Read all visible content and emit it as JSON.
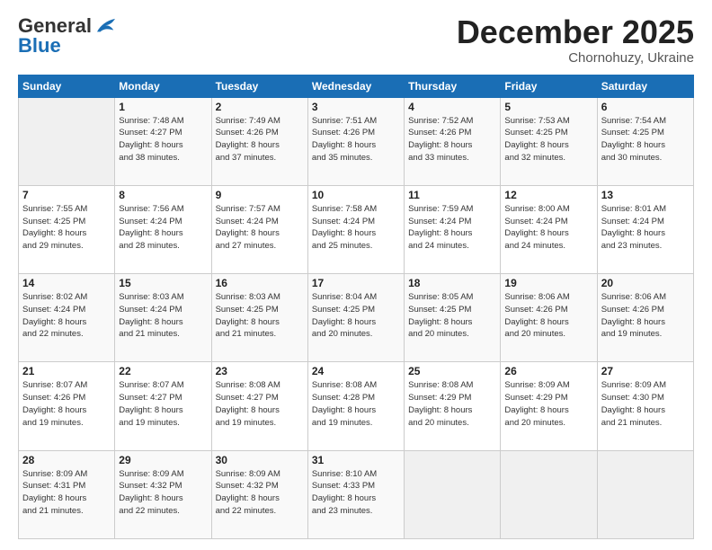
{
  "header": {
    "logo_general": "General",
    "logo_blue": "Blue",
    "month_title": "December 2025",
    "location": "Chornohuzy, Ukraine"
  },
  "weekdays": [
    "Sunday",
    "Monday",
    "Tuesday",
    "Wednesday",
    "Thursday",
    "Friday",
    "Saturday"
  ],
  "weeks": [
    [
      {
        "day": "",
        "info": ""
      },
      {
        "day": "1",
        "info": "Sunrise: 7:48 AM\nSunset: 4:27 PM\nDaylight: 8 hours\nand 38 minutes."
      },
      {
        "day": "2",
        "info": "Sunrise: 7:49 AM\nSunset: 4:26 PM\nDaylight: 8 hours\nand 37 minutes."
      },
      {
        "day": "3",
        "info": "Sunrise: 7:51 AM\nSunset: 4:26 PM\nDaylight: 8 hours\nand 35 minutes."
      },
      {
        "day": "4",
        "info": "Sunrise: 7:52 AM\nSunset: 4:26 PM\nDaylight: 8 hours\nand 33 minutes."
      },
      {
        "day": "5",
        "info": "Sunrise: 7:53 AM\nSunset: 4:25 PM\nDaylight: 8 hours\nand 32 minutes."
      },
      {
        "day": "6",
        "info": "Sunrise: 7:54 AM\nSunset: 4:25 PM\nDaylight: 8 hours\nand 30 minutes."
      }
    ],
    [
      {
        "day": "7",
        "info": "Sunrise: 7:55 AM\nSunset: 4:25 PM\nDaylight: 8 hours\nand 29 minutes."
      },
      {
        "day": "8",
        "info": "Sunrise: 7:56 AM\nSunset: 4:24 PM\nDaylight: 8 hours\nand 28 minutes."
      },
      {
        "day": "9",
        "info": "Sunrise: 7:57 AM\nSunset: 4:24 PM\nDaylight: 8 hours\nand 27 minutes."
      },
      {
        "day": "10",
        "info": "Sunrise: 7:58 AM\nSunset: 4:24 PM\nDaylight: 8 hours\nand 25 minutes."
      },
      {
        "day": "11",
        "info": "Sunrise: 7:59 AM\nSunset: 4:24 PM\nDaylight: 8 hours\nand 24 minutes."
      },
      {
        "day": "12",
        "info": "Sunrise: 8:00 AM\nSunset: 4:24 PM\nDaylight: 8 hours\nand 24 minutes."
      },
      {
        "day": "13",
        "info": "Sunrise: 8:01 AM\nSunset: 4:24 PM\nDaylight: 8 hours\nand 23 minutes."
      }
    ],
    [
      {
        "day": "14",
        "info": "Sunrise: 8:02 AM\nSunset: 4:24 PM\nDaylight: 8 hours\nand 22 minutes."
      },
      {
        "day": "15",
        "info": "Sunrise: 8:03 AM\nSunset: 4:24 PM\nDaylight: 8 hours\nand 21 minutes."
      },
      {
        "day": "16",
        "info": "Sunrise: 8:03 AM\nSunset: 4:25 PM\nDaylight: 8 hours\nand 21 minutes."
      },
      {
        "day": "17",
        "info": "Sunrise: 8:04 AM\nSunset: 4:25 PM\nDaylight: 8 hours\nand 20 minutes."
      },
      {
        "day": "18",
        "info": "Sunrise: 8:05 AM\nSunset: 4:25 PM\nDaylight: 8 hours\nand 20 minutes."
      },
      {
        "day": "19",
        "info": "Sunrise: 8:06 AM\nSunset: 4:26 PM\nDaylight: 8 hours\nand 20 minutes."
      },
      {
        "day": "20",
        "info": "Sunrise: 8:06 AM\nSunset: 4:26 PM\nDaylight: 8 hours\nand 19 minutes."
      }
    ],
    [
      {
        "day": "21",
        "info": "Sunrise: 8:07 AM\nSunset: 4:26 PM\nDaylight: 8 hours\nand 19 minutes."
      },
      {
        "day": "22",
        "info": "Sunrise: 8:07 AM\nSunset: 4:27 PM\nDaylight: 8 hours\nand 19 minutes."
      },
      {
        "day": "23",
        "info": "Sunrise: 8:08 AM\nSunset: 4:27 PM\nDaylight: 8 hours\nand 19 minutes."
      },
      {
        "day": "24",
        "info": "Sunrise: 8:08 AM\nSunset: 4:28 PM\nDaylight: 8 hours\nand 19 minutes."
      },
      {
        "day": "25",
        "info": "Sunrise: 8:08 AM\nSunset: 4:29 PM\nDaylight: 8 hours\nand 20 minutes."
      },
      {
        "day": "26",
        "info": "Sunrise: 8:09 AM\nSunset: 4:29 PM\nDaylight: 8 hours\nand 20 minutes."
      },
      {
        "day": "27",
        "info": "Sunrise: 8:09 AM\nSunset: 4:30 PM\nDaylight: 8 hours\nand 21 minutes."
      }
    ],
    [
      {
        "day": "28",
        "info": "Sunrise: 8:09 AM\nSunset: 4:31 PM\nDaylight: 8 hours\nand 21 minutes."
      },
      {
        "day": "29",
        "info": "Sunrise: 8:09 AM\nSunset: 4:32 PM\nDaylight: 8 hours\nand 22 minutes."
      },
      {
        "day": "30",
        "info": "Sunrise: 8:09 AM\nSunset: 4:32 PM\nDaylight: 8 hours\nand 22 minutes."
      },
      {
        "day": "31",
        "info": "Sunrise: 8:10 AM\nSunset: 4:33 PM\nDaylight: 8 hours\nand 23 minutes."
      },
      {
        "day": "",
        "info": ""
      },
      {
        "day": "",
        "info": ""
      },
      {
        "day": "",
        "info": ""
      }
    ]
  ]
}
